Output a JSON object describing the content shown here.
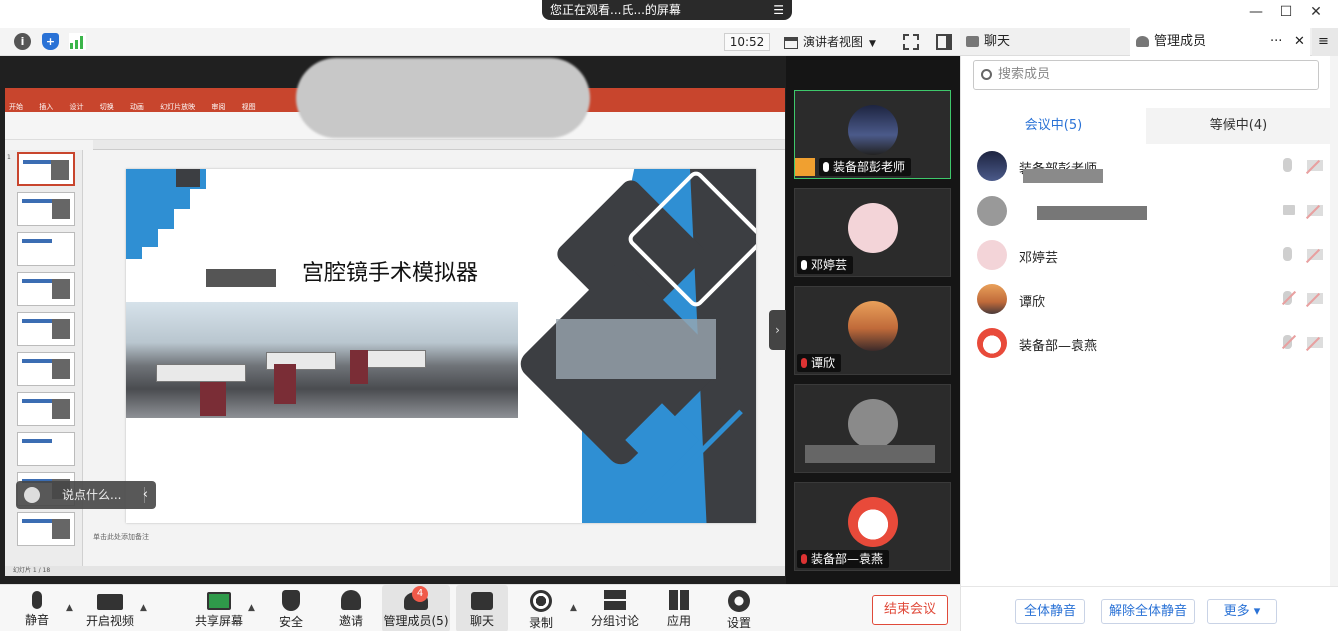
{
  "share_banner": {
    "text": "您正在观看...氏...的屏幕",
    "menu_glyph": "☰"
  },
  "window_controls": {
    "minimize": "—",
    "maximize": "☐",
    "close": "✕"
  },
  "meeting_bar": {
    "timer": "10:52",
    "view_mode": "演讲者视图",
    "icons": [
      "info-icon",
      "shield-icon",
      "signal-icon",
      "fullscreen-icon",
      "split-layout-icon"
    ]
  },
  "panel_tabs": {
    "chat": "聊天",
    "members": "管理成员",
    "more": "···",
    "close": "✕"
  },
  "slide": {
    "title": "宫腔镜手术模拟器"
  },
  "ppt": {
    "tabs": [
      "开始",
      "插入",
      "设计",
      "切换",
      "动画",
      "幻灯片放映",
      "审阅",
      "视图"
    ],
    "status": "幻灯片 1 / 18",
    "notes": "单击此处添加备注"
  },
  "chat_float": {
    "placeholder": "说点什么...",
    "collapse": "‹"
  },
  "video_tiles": [
    {
      "name": "装备部彭老师",
      "mic": "on",
      "host": true,
      "active": true
    },
    {
      "name": "邓婷芸",
      "mic": "on",
      "host": false,
      "active": false
    },
    {
      "name": "谭欣",
      "mic": "off",
      "host": false,
      "active": false
    },
    {
      "name": "",
      "mic": "none",
      "host": false,
      "active": false
    },
    {
      "name": "装备部—袁燕",
      "mic": "off",
      "host": false,
      "active": false
    }
  ],
  "panel": {
    "search_placeholder": "搜索成员",
    "tab_in_meeting": "会议中(5)",
    "tab_waiting": "等候中(4)",
    "members": [
      {
        "name": "装备部彭老师",
        "mic": "on",
        "cam": "off"
      },
      {
        "name": "",
        "mic": "screen",
        "cam": "off"
      },
      {
        "name": "邓婷芸",
        "mic": "on",
        "cam": "off"
      },
      {
        "name": "谭欣",
        "mic": "off",
        "cam": "off"
      },
      {
        "name": "装备部—袁燕",
        "mic": "off",
        "cam": "off"
      }
    ],
    "mute_all": "全体静音",
    "unmute_all": "解除全体静音",
    "more": "更多 ▾"
  },
  "toolbar": {
    "mute": "静音",
    "video": "开启视频",
    "share": "共享屏幕",
    "security": "安全",
    "invite": "邀请",
    "members": "管理成员(5)",
    "members_badge": "4",
    "chat": "聊天",
    "record": "录制",
    "breakout": "分组讨论",
    "apps": "应用",
    "settings": "设置",
    "end": "结束会议"
  },
  "colors": {
    "accent_blue": "#2a72d6",
    "end_red": "#e04a3a",
    "active_green": "#3ec86b",
    "ppt_red": "#c8452d",
    "slide_blue": "#2f8fd3"
  }
}
